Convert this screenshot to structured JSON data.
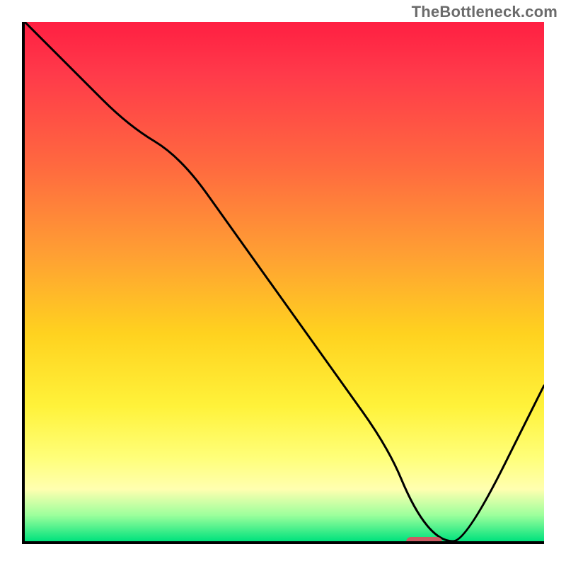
{
  "attribution": "TheBottleneck.com",
  "chart_data": {
    "type": "line",
    "title": "",
    "xlabel": "",
    "ylabel": "",
    "xlim": [
      0,
      100
    ],
    "ylim": [
      0,
      100
    ],
    "x": [
      0,
      10,
      20,
      30,
      40,
      50,
      60,
      70,
      75,
      80,
      85,
      100
    ],
    "y": [
      100,
      90,
      80,
      74,
      60,
      46,
      32,
      18,
      6,
      0,
      0,
      30
    ],
    "marker": {
      "x_from": 73,
      "x_to": 80,
      "y": 0
    },
    "gradient_stops": [
      {
        "pos": 0,
        "color": "#ff1f42"
      },
      {
        "pos": 10,
        "color": "#ff3a4a"
      },
      {
        "pos": 28,
        "color": "#ff6a3f"
      },
      {
        "pos": 45,
        "color": "#ffa033"
      },
      {
        "pos": 60,
        "color": "#ffd21f"
      },
      {
        "pos": 74,
        "color": "#fff23a"
      },
      {
        "pos": 84,
        "color": "#ffff7a"
      },
      {
        "pos": 90,
        "color": "#ffffb0"
      },
      {
        "pos": 95,
        "color": "#9cff9c"
      },
      {
        "pos": 100,
        "color": "#00e27d"
      }
    ]
  }
}
